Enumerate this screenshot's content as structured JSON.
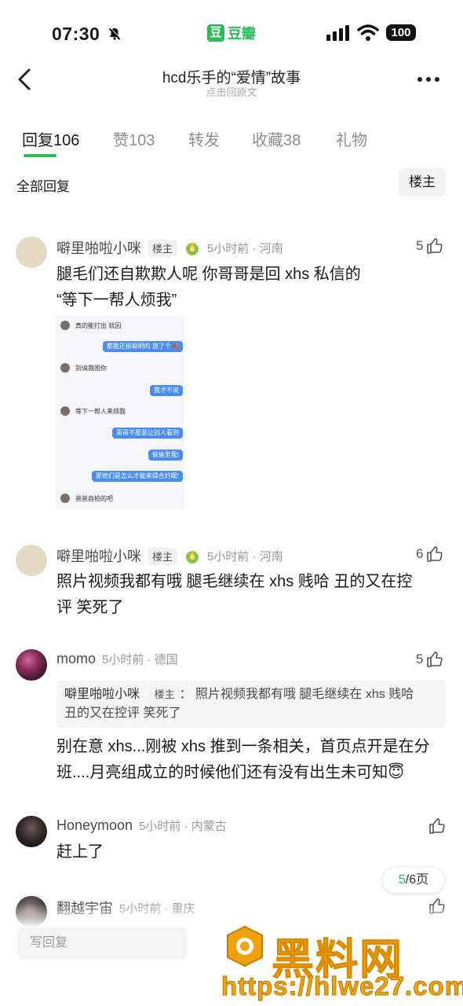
{
  "status_bar": {
    "time": "07:30",
    "app_name": "豆瓣",
    "app_logo": "豆",
    "battery": "100"
  },
  "nav": {
    "title": "hcd乐手的“爱情”故事",
    "subtitle": "点击回原文"
  },
  "tabs": [
    {
      "label": "回复",
      "count": "106",
      "active": true
    },
    {
      "label": "赞",
      "count": "103"
    },
    {
      "label": "转发",
      "count": ""
    },
    {
      "label": "收藏",
      "count": "38"
    },
    {
      "label": "礼物",
      "count": ""
    }
  ],
  "filters": {
    "all_replies": "全部回复",
    "owner_only": "楼主"
  },
  "comments": [
    {
      "username": "噼里啪啦小咪",
      "owner_tag": "楼主",
      "time_loc": "5小时前 · 河南",
      "likes": "5",
      "lines": [
        "腿毛们还自欺欺人呢 你哥哥是回 xhs 私信的",
        "“等下一帮人烦我”"
      ],
      "screenshot": [
        {
          "side": "left",
          "text": "真的能打出 就因"
        },
        {
          "side": "right",
          "text": "都我还挺聪明的 放了个🍂"
        },
        {
          "side": "left",
          "text": "别说我图你"
        },
        {
          "side": "right",
          "text": "我才不说"
        },
        {
          "side": "left",
          "text": "等下一帮人来烦我"
        },
        {
          "side": "right",
          "text": "哥哥不愿意让别人看到"
        },
        {
          "side": "right",
          "text": "偷偷里我!"
        },
        {
          "side": "right",
          "text": "那他们是怎么才能来得合约呢!"
        },
        {
          "side": "left",
          "text": "爸爸自拍的吧"
        }
      ]
    },
    {
      "username": "噼里啪啦小咪",
      "owner_tag": "楼主",
      "time_loc": "5小时前 · 河南",
      "likes": "6",
      "lines": [
        "照片视频我都有哦 腿毛继续在 xhs 贱哈 丑的又在控",
        "评 笑死了"
      ]
    },
    {
      "username": "momo",
      "time_loc": "5小时前 · 德国",
      "likes": "5",
      "quote": {
        "name": "噼里啪啦小咪",
        "tag": "楼主",
        "sep": "：",
        "line1": "照片视频我都有哦 腿毛继续在 xhs 贱哈",
        "line2": "丑的又在控评 笑死了"
      },
      "lines": [
        "别在意 xhs...刚被 xhs 推到一条相关，首页点开是在分",
        "班....月亮组成立的时候他们还有没有出生未可知😇"
      ]
    },
    {
      "username": "Honeymoon",
      "time_loc": "5小时前 · 内蒙古",
      "likes": "",
      "lines": [
        "赶上了"
      ]
    },
    {
      "username": "翻越宇宙",
      "time_loc": "5小时前 · 重庆",
      "likes": ""
    }
  ],
  "pager": {
    "current": "5",
    "total": "/6页"
  },
  "reply_placeholder": "写回复",
  "watermark": {
    "text": "黑料网",
    "url": "https://hlwe27.com"
  },
  "colors": {
    "accent": "#2dbb57",
    "watermark": "#f2a20c"
  }
}
